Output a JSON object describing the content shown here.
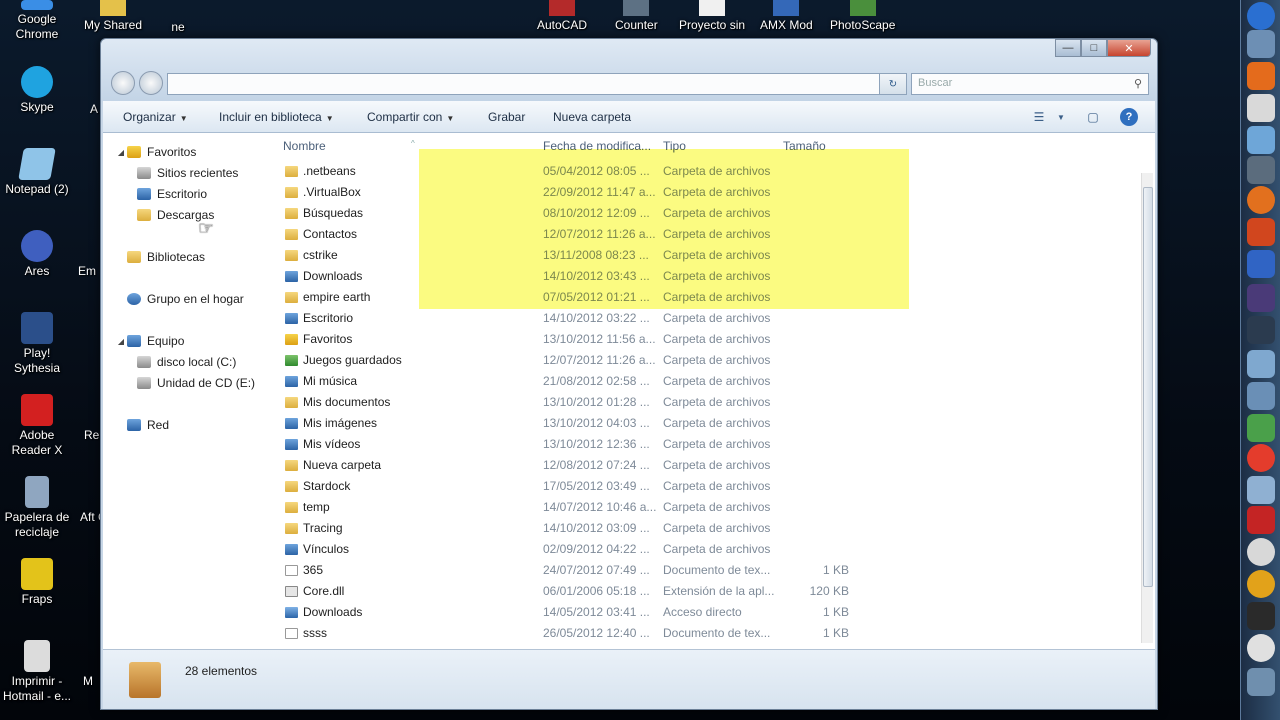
{
  "desktop": {
    "left_icons": [
      {
        "label": "Google Chrome",
        "color": "#3a8ee6"
      },
      {
        "label": "Skype",
        "color": "#1fa3e0"
      },
      {
        "label": "Notepad (2)",
        "color": "#8fc4e8"
      },
      {
        "label": "Ares",
        "color": "#3f5fbf"
      },
      {
        "label": "Play! Sythesia",
        "color": "#2b4f8a"
      },
      {
        "label": "Adobe Reader X",
        "color": "#d32020"
      },
      {
        "label": "Papelera de reciclaje",
        "color": "#8fa6c0"
      },
      {
        "label": "Fraps",
        "color": "#e3c31a"
      },
      {
        "label": "Imprimir - Hotmail - e...",
        "color": "#dcdcdc"
      }
    ],
    "partial_labels": [
      "A",
      "Em",
      "Re",
      "Aft CS",
      "M"
    ],
    "top_icons": [
      {
        "label": "My Shared"
      },
      {
        "label": "AutoCAD"
      },
      {
        "label": "Counter"
      },
      {
        "label": "Proyecto sin"
      },
      {
        "label": "AMX Mod"
      },
      {
        "label": "PhotoScape"
      }
    ],
    "top_partial": "ne"
  },
  "window": {
    "search_placeholder": "Buscar",
    "toolbar": {
      "organize": "Organizar",
      "include_library": "Incluir en biblioteca",
      "share_with": "Compartir con",
      "burn": "Grabar",
      "new_folder": "Nueva carpeta"
    },
    "nav": {
      "favorites": "Favoritos",
      "recent": "Sitios recientes",
      "desktop": "Escritorio",
      "downloads": "Descargas",
      "libraries": "Bibliotecas",
      "homegroup": "Grupo en el hogar",
      "computer": "Equipo",
      "local_disk": "disco local (C:)",
      "cd_drive": "Unidad de CD (E:)",
      "network": "Red"
    },
    "columns": {
      "name": "Nombre",
      "date": "Fecha de modifica...",
      "type": "Tipo",
      "size": "Tamaño"
    },
    "files": [
      {
        "name": ".netbeans",
        "date": "05/04/2012 08:05 ...",
        "type": "Carpeta de archivos",
        "size": "",
        "icon": "folder"
      },
      {
        "name": ".VirtualBox",
        "date": "22/09/2012 11:47 a...",
        "type": "Carpeta de archivos",
        "size": "",
        "icon": "folder"
      },
      {
        "name": "Búsquedas",
        "date": "08/10/2012 12:09 ...",
        "type": "Carpeta de archivos",
        "size": "",
        "icon": "folder"
      },
      {
        "name": "Contactos",
        "date": "12/07/2012 11:26 a...",
        "type": "Carpeta de archivos",
        "size": "",
        "icon": "folder"
      },
      {
        "name": "cstrike",
        "date": "13/11/2008 08:23 ...",
        "type": "Carpeta de archivos",
        "size": "",
        "icon": "folder"
      },
      {
        "name": "Downloads",
        "date": "14/10/2012 03:43 ...",
        "type": "Carpeta de archivos",
        "size": "",
        "icon": "blue"
      },
      {
        "name": "empire earth",
        "date": "07/05/2012 01:21 ...",
        "type": "Carpeta de archivos",
        "size": "",
        "icon": "folder"
      },
      {
        "name": "Escritorio",
        "date": "14/10/2012 03:22 ...",
        "type": "Carpeta de archivos",
        "size": "",
        "icon": "blue"
      },
      {
        "name": "Favoritos",
        "date": "13/10/2012 11:56 a...",
        "type": "Carpeta de archivos",
        "size": "",
        "icon": "star"
      },
      {
        "name": "Juegos guardados",
        "date": "12/07/2012 11:26 a...",
        "type": "Carpeta de archivos",
        "size": "",
        "icon": "green"
      },
      {
        "name": "Mi música",
        "date": "21/08/2012 02:58 ...",
        "type": "Carpeta de archivos",
        "size": "",
        "icon": "blue"
      },
      {
        "name": "Mis documentos",
        "date": "13/10/2012 01:28 ...",
        "type": "Carpeta de archivos",
        "size": "",
        "icon": "folder"
      },
      {
        "name": "Mis imágenes",
        "date": "13/10/2012 04:03 ...",
        "type": "Carpeta de archivos",
        "size": "",
        "icon": "blue"
      },
      {
        "name": "Mis vídeos",
        "date": "13/10/2012 12:36 ...",
        "type": "Carpeta de archivos",
        "size": "",
        "icon": "blue"
      },
      {
        "name": "Nueva carpeta",
        "date": "12/08/2012 07:24 ...",
        "type": "Carpeta de archivos",
        "size": "",
        "icon": "folder"
      },
      {
        "name": "Stardock",
        "date": "17/05/2012 03:49 ...",
        "type": "Carpeta de archivos",
        "size": "",
        "icon": "folder"
      },
      {
        "name": "temp",
        "date": "14/07/2012 10:46 a...",
        "type": "Carpeta de archivos",
        "size": "",
        "icon": "folder"
      },
      {
        "name": "Tracing",
        "date": "14/10/2012 03:09 ...",
        "type": "Carpeta de archivos",
        "size": "",
        "icon": "folder"
      },
      {
        "name": "Vínculos",
        "date": "02/09/2012 04:22 ...",
        "type": "Carpeta de archivos",
        "size": "",
        "icon": "blue"
      },
      {
        "name": "365",
        "date": "24/07/2012 07:49 ...",
        "type": "Documento de tex...",
        "size": "1 KB",
        "icon": "txt"
      },
      {
        "name": "Core.dll",
        "date": "06/01/2006 05:18 ...",
        "type": "Extensión de la apl...",
        "size": "120 KB",
        "icon": "dll"
      },
      {
        "name": "Downloads",
        "date": "14/05/2012 03:41 ...",
        "type": "Acceso directo",
        "size": "1 KB",
        "icon": "shortcut"
      },
      {
        "name": "ssss",
        "date": "26/05/2012 12:40 ...",
        "type": "Documento de tex...",
        "size": "1 KB",
        "icon": "txt"
      }
    ],
    "status": {
      "item_count": "28 elementos"
    }
  },
  "colors": {
    "highlight": "#f5f550",
    "window_frame": "#c7d6e6",
    "accent": "#2f6fbf"
  }
}
